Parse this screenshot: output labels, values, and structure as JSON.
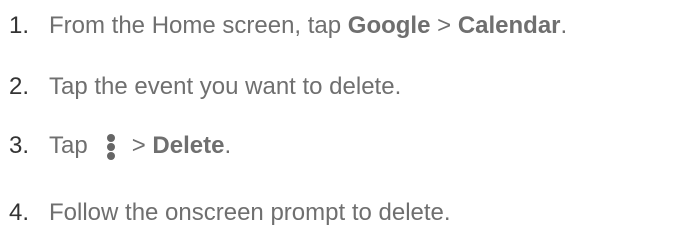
{
  "steps": [
    {
      "number": "1.",
      "text_before": "From the Home screen, tap ",
      "bold1": "Google",
      "middle": " > ",
      "bold2": "Calendar",
      "text_after": "."
    },
    {
      "number": "2.",
      "text": "Tap the event you want to delete."
    },
    {
      "number": "3.",
      "text_before": "Tap",
      "icon": "more-vertical-icon",
      "middle": "> ",
      "bold": "Delete",
      "text_after": "."
    },
    {
      "number": "4.",
      "text": "Follow the onscreen prompt to delete."
    }
  ]
}
